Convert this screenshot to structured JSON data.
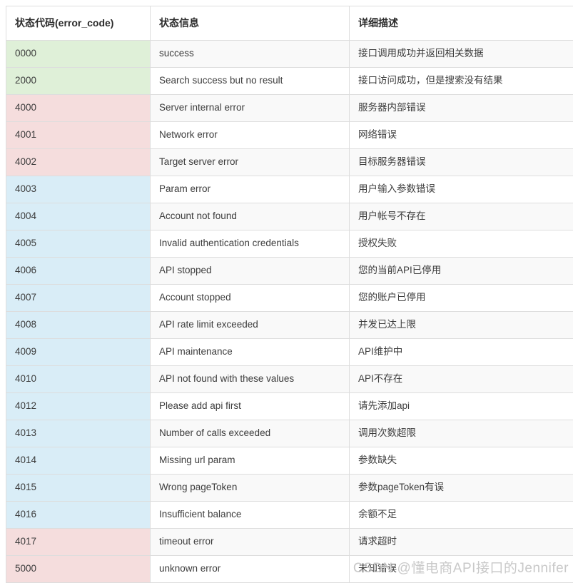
{
  "table": {
    "columns": [
      "状态代码(error_code)",
      "状态信息",
      "详细描述"
    ],
    "tones": {
      "success": "#dff0d8",
      "error": "#f5dddd",
      "info": "#d9edf7"
    },
    "rows": [
      {
        "code": "0000",
        "message": "success",
        "description": "接口调用成功并返回相关数据",
        "tone": "success"
      },
      {
        "code": "2000",
        "message": "Search success but no result",
        "description": "接口访问成功，但是搜索没有结果",
        "tone": "success"
      },
      {
        "code": "4000",
        "message": "Server internal error",
        "description": "服务器内部错误",
        "tone": "error"
      },
      {
        "code": "4001",
        "message": "Network error",
        "description": "网络错误",
        "tone": "error"
      },
      {
        "code": "4002",
        "message": "Target server error",
        "description": "目标服务器错误",
        "tone": "error"
      },
      {
        "code": "4003",
        "message": "Param error",
        "description": "用户输入参数错误",
        "tone": "info"
      },
      {
        "code": "4004",
        "message": "Account not found",
        "description": "用户帐号不存在",
        "tone": "info"
      },
      {
        "code": "4005",
        "message": "Invalid authentication credentials",
        "description": "授权失败",
        "tone": "info"
      },
      {
        "code": "4006",
        "message": "API stopped",
        "description": "您的当前API已停用",
        "tone": "info"
      },
      {
        "code": "4007",
        "message": "Account stopped",
        "description": "您的账户已停用",
        "tone": "info"
      },
      {
        "code": "4008",
        "message": "API rate limit exceeded",
        "description": "并发已达上限",
        "tone": "info"
      },
      {
        "code": "4009",
        "message": "API maintenance",
        "description": "API维护中",
        "tone": "info"
      },
      {
        "code": "4010",
        "message": "API not found with these values",
        "description": "API不存在",
        "tone": "info"
      },
      {
        "code": "4012",
        "message": "Please add api first",
        "description": "请先添加api",
        "tone": "info"
      },
      {
        "code": "4013",
        "message": "Number of calls exceeded",
        "description": "调用次数超限",
        "tone": "info"
      },
      {
        "code": "4014",
        "message": "Missing url param",
        "description": "参数缺失",
        "tone": "info"
      },
      {
        "code": "4015",
        "message": "Wrong pageToken",
        "description": "参数pageToken有误",
        "tone": "info"
      },
      {
        "code": "4016",
        "message": "Insufficient balance",
        "description": "余额不足",
        "tone": "info"
      },
      {
        "code": "4017",
        "message": "timeout error",
        "description": "请求超时",
        "tone": "error"
      },
      {
        "code": "5000",
        "message": "unknown error",
        "description": "未知错误",
        "tone": "error"
      }
    ]
  },
  "watermark": "CSDN @懂电商API接口的Jennifer"
}
